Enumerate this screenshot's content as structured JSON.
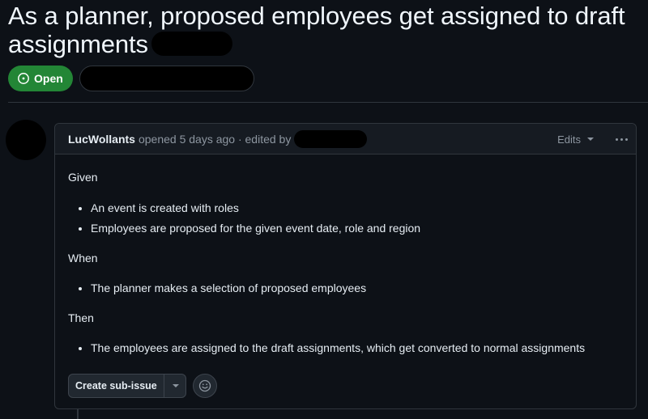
{
  "issue": {
    "title": "As a planner, proposed employees get assigned to draft assignments",
    "state_label": "Open"
  },
  "comment": {
    "author": "LucWollants",
    "opened_text": "opened 5 days ago · edited by",
    "edits_label": "Edits",
    "body": {
      "given_heading": "Given",
      "given_items": [
        "An event is created with roles",
        "Employees are proposed for the given event date, role and region"
      ],
      "when_heading": "When",
      "when_items": [
        "The planner makes a selection of proposed employees"
      ],
      "then_heading": "Then",
      "then_items": [
        "The employees are assigned to the draft assignments, which get converted to normal assignments"
      ]
    },
    "create_subissue_label": "Create sub-issue"
  },
  "icons": {
    "state": "issue-opened-icon",
    "edits_caret": "triangle-down-icon",
    "more": "kebab-horizontal-icon",
    "split_caret": "triangle-down-icon",
    "reaction": "smiley-icon"
  },
  "colors": {
    "background": "#0d1117",
    "open_badge": "#238636",
    "border": "#30363d",
    "header_bg": "#161b22",
    "muted_text": "#8d96a0"
  }
}
